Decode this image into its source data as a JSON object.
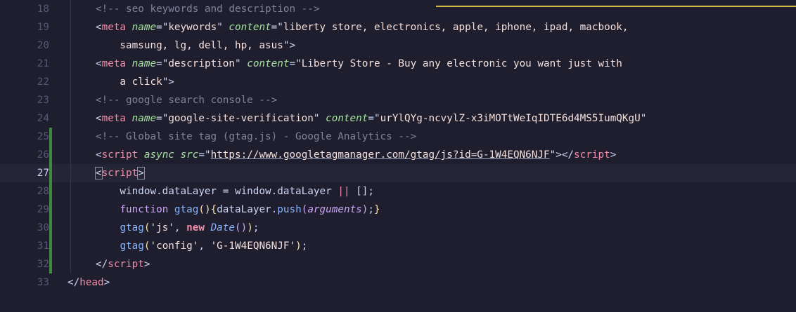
{
  "editor": {
    "lines": [
      {
        "num": "18",
        "tokens": [
          {
            "t": "cm",
            "v": "<!-- seo keywords and description -->"
          }
        ]
      },
      {
        "num": "19",
        "tokens": [
          {
            "t": "punc",
            "v": "<"
          },
          {
            "t": "tag",
            "v": "meta"
          },
          {
            "t": "plain",
            "v": " "
          },
          {
            "t": "attr",
            "v": "name"
          },
          {
            "t": "punc",
            "v": "=\""
          },
          {
            "t": "str",
            "v": "keywords"
          },
          {
            "t": "punc",
            "v": "\" "
          },
          {
            "t": "attr",
            "v": "content"
          },
          {
            "t": "punc",
            "v": "=\""
          },
          {
            "t": "str",
            "v": "liberty store, electronics, apple, iphone, ipad, macbook,"
          }
        ]
      },
      {
        "num": "20",
        "tokens": [
          {
            "t": "str",
            "v": "    samsung, lg, dell, hp, asus"
          },
          {
            "t": "punc",
            "v": "\">"
          }
        ]
      },
      {
        "num": "21",
        "tokens": [
          {
            "t": "punc",
            "v": "<"
          },
          {
            "t": "tag",
            "v": "meta"
          },
          {
            "t": "plain",
            "v": " "
          },
          {
            "t": "attr",
            "v": "name"
          },
          {
            "t": "punc",
            "v": "=\""
          },
          {
            "t": "str",
            "v": "description"
          },
          {
            "t": "punc",
            "v": "\" "
          },
          {
            "t": "attr",
            "v": "content"
          },
          {
            "t": "punc",
            "v": "=\""
          },
          {
            "t": "str",
            "v": "Liberty Store - Buy any electronic you want just with"
          }
        ]
      },
      {
        "num": "22",
        "tokens": [
          {
            "t": "str",
            "v": "    a click"
          },
          {
            "t": "punc",
            "v": "\">"
          }
        ]
      },
      {
        "num": "23",
        "tokens": [
          {
            "t": "cm",
            "v": "<!-- google search console -->"
          }
        ]
      },
      {
        "num": "24",
        "tokens": [
          {
            "t": "punc",
            "v": "<"
          },
          {
            "t": "tag",
            "v": "meta"
          },
          {
            "t": "plain",
            "v": " "
          },
          {
            "t": "attr",
            "v": "name"
          },
          {
            "t": "punc",
            "v": "=\""
          },
          {
            "t": "str",
            "v": "google-site-verification"
          },
          {
            "t": "punc",
            "v": "\" "
          },
          {
            "t": "attr",
            "v": "content"
          },
          {
            "t": "punc",
            "v": "=\""
          },
          {
            "t": "str",
            "v": "urYlQYg-ncvylZ-x3iMOTtWeIqIDTE6d4MS5IumQKgU"
          },
          {
            "t": "punc",
            "v": "\""
          }
        ]
      },
      {
        "num": "25",
        "git": true,
        "tokens": [
          {
            "t": "cm",
            "v": "<!-- Global site tag (gtag.js) - Google Analytics -->"
          }
        ]
      },
      {
        "num": "26",
        "git": true,
        "tokens": [
          {
            "t": "punc",
            "v": "<"
          },
          {
            "t": "tag",
            "v": "script"
          },
          {
            "t": "plain",
            "v": " "
          },
          {
            "t": "attr",
            "v": "async"
          },
          {
            "t": "plain",
            "v": " "
          },
          {
            "t": "attr",
            "v": "src"
          },
          {
            "t": "punc",
            "v": "=\""
          },
          {
            "t": "url",
            "v": "https://www.googletagmanager.com/gtag/js?id=G-1W4EQN6NJF"
          },
          {
            "t": "punc",
            "v": "\"></"
          },
          {
            "t": "tag",
            "v": "script"
          },
          {
            "t": "punc",
            "v": ">"
          }
        ]
      },
      {
        "num": "27",
        "git": true,
        "active": true,
        "tokens": [
          {
            "t": "punc box",
            "v": "<"
          },
          {
            "t": "tag",
            "v": "script"
          },
          {
            "t": "punc box",
            "v": ">"
          }
        ]
      },
      {
        "num": "28",
        "git": true,
        "tokens": [
          {
            "t": "plain",
            "v": "    window.dataLayer = window.dataLayer "
          },
          {
            "t": "op",
            "v": "||"
          },
          {
            "t": "plain",
            "v": " [];"
          }
        ]
      },
      {
        "num": "29",
        "git": true,
        "tokens": [
          {
            "t": "plain",
            "v": "    "
          },
          {
            "t": "kwp",
            "v": "function"
          },
          {
            "t": "plain",
            "v": " "
          },
          {
            "t": "fn",
            "v": "gtag"
          },
          {
            "t": "brk",
            "v": "()"
          },
          {
            "t": "brk",
            "v": "{"
          },
          {
            "t": "plain",
            "v": "dataLayer."
          },
          {
            "t": "fn",
            "v": "push"
          },
          {
            "t": "kwp",
            "v": "("
          },
          {
            "t": "args",
            "v": "arguments"
          },
          {
            "t": "kwp",
            "v": ")"
          },
          {
            "t": "plain",
            "v": ";"
          },
          {
            "t": "brk",
            "v": "}"
          }
        ]
      },
      {
        "num": "30",
        "git": true,
        "tokens": [
          {
            "t": "plain",
            "v": "    "
          },
          {
            "t": "fn",
            "v": "gtag"
          },
          {
            "t": "brk",
            "v": "("
          },
          {
            "t": "str",
            "v": "'js'"
          },
          {
            "t": "plain",
            "v": ", "
          },
          {
            "t": "kw",
            "v": "new"
          },
          {
            "t": "plain",
            "v": " "
          },
          {
            "t": "typ",
            "v": "Date"
          },
          {
            "t": "kwp",
            "v": "()"
          },
          {
            "t": "brk",
            "v": ")"
          },
          {
            "t": "plain",
            "v": ";"
          }
        ]
      },
      {
        "num": "31",
        "git": true,
        "tokens": [
          {
            "t": "plain",
            "v": "    "
          },
          {
            "t": "fn",
            "v": "gtag"
          },
          {
            "t": "brk",
            "v": "("
          },
          {
            "t": "str",
            "v": "'config'"
          },
          {
            "t": "plain",
            "v": ", "
          },
          {
            "t": "str",
            "v": "'G-1W4EQN6NJF'"
          },
          {
            "t": "brk",
            "v": ")"
          },
          {
            "t": "plain",
            "v": ";"
          }
        ]
      },
      {
        "num": "32",
        "git": true,
        "tokens": [
          {
            "t": "punc",
            "v": "</"
          },
          {
            "t": "tag",
            "v": "script"
          },
          {
            "t": "punc",
            "v": ">"
          }
        ]
      },
      {
        "num": "33",
        "outdent": true,
        "tokens": [
          {
            "t": "punc",
            "v": "</"
          },
          {
            "t": "tag",
            "v": "head"
          },
          {
            "t": "punc",
            "v": ">"
          }
        ]
      }
    ]
  },
  "colors": {
    "background": "#1e1e2e",
    "git_added": "#3e8a3e",
    "tag": "#f38ba8",
    "attribute": "#a6e3a1",
    "string": "#f5e0dc",
    "comment": "#7f849c"
  }
}
